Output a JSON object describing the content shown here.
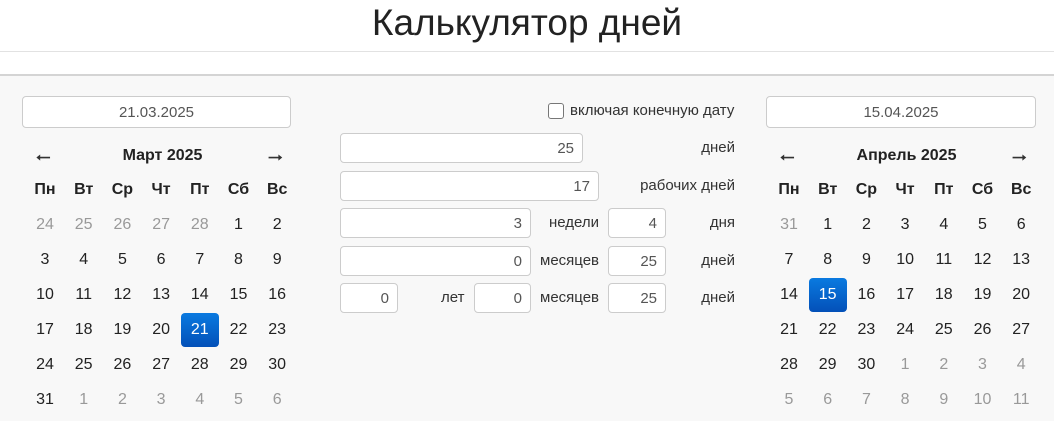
{
  "title": "Калькулятор дней",
  "start": {
    "value": "21.03.2025",
    "month_title": "Март 2025",
    "selected": 21,
    "weeks": [
      [
        24,
        25,
        26,
        27,
        28,
        1,
        2
      ],
      [
        3,
        4,
        5,
        6,
        7,
        8,
        9
      ],
      [
        10,
        11,
        12,
        13,
        14,
        15,
        16
      ],
      [
        17,
        18,
        19,
        20,
        21,
        22,
        23
      ],
      [
        24,
        25,
        26,
        27,
        28,
        29,
        30
      ],
      [
        31,
        1,
        2,
        3,
        4,
        5,
        6
      ]
    ],
    "first_row_other": 5,
    "last_row_other_from": 1
  },
  "end": {
    "value": "15.04.2025",
    "month_title": "Апрель 2025",
    "selected": 15,
    "weeks": [
      [
        31,
        1,
        2,
        3,
        4,
        5,
        6
      ],
      [
        7,
        8,
        9,
        10,
        11,
        12,
        13
      ],
      [
        14,
        15,
        16,
        17,
        18,
        19,
        20
      ],
      [
        21,
        22,
        23,
        24,
        25,
        26,
        27
      ],
      [
        28,
        29,
        30,
        1,
        2,
        3,
        4
      ],
      [
        5,
        6,
        7,
        8,
        9,
        10,
        11
      ]
    ]
  },
  "weekdays": [
    "Пн",
    "Вт",
    "Ср",
    "Чт",
    "Пт",
    "Сб",
    "Вс"
  ],
  "icons": {
    "prev": "arrow-left-icon",
    "next": "arrow-right-icon"
  },
  "include_end_label": "включая конечную дату",
  "include_end_checked": false,
  "calc": {
    "days": "25",
    "days_label": "дней",
    "workdays": "17",
    "workdays_label": "рабочих дней",
    "weeks": "3",
    "weeks_label": "недели",
    "weeks_days": "4",
    "weeks_days_label": "дня",
    "months": "0",
    "months_label": "месяцев",
    "months_days": "25",
    "months_days_label": "дней",
    "ymd_years": "0",
    "ymd_years_label": "лет",
    "ymd_months": "0",
    "ymd_months_label": "месяцев",
    "ymd_days": "25",
    "ymd_days_label": "дней"
  },
  "colors": {
    "selected": "#0a66d0"
  }
}
